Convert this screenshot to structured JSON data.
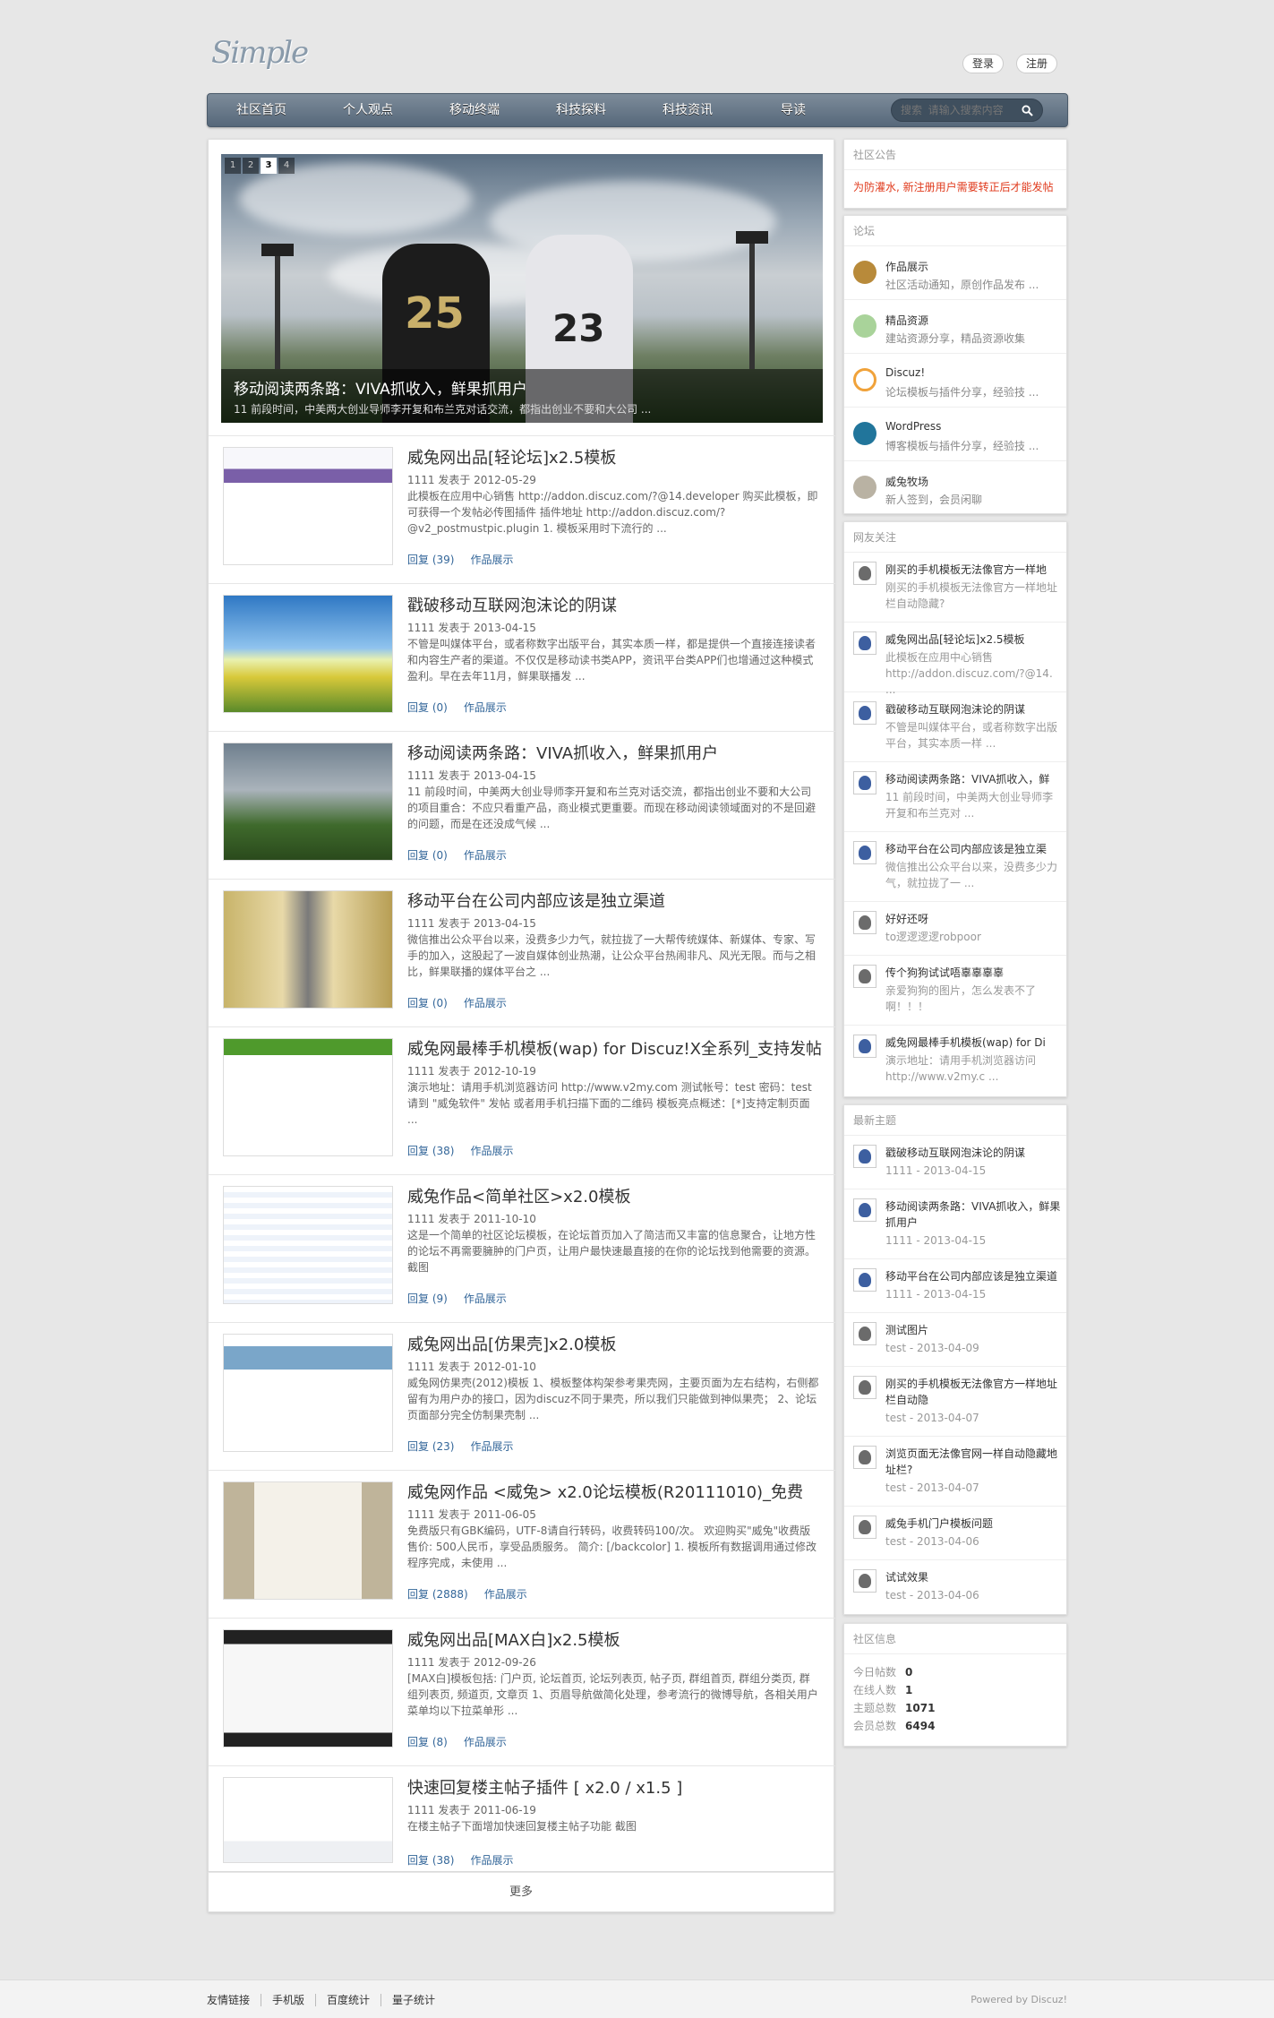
{
  "header": {
    "logo": "Simple",
    "login": "登录",
    "register": "注册"
  },
  "nav": {
    "items": [
      "社区首页",
      "个人观点",
      "移动终端",
      "科技探料",
      "科技资讯",
      "导读"
    ],
    "search_placeholder": "搜索  请输入搜索内容"
  },
  "slider": {
    "pages": [
      "1",
      "2",
      "3",
      "4"
    ],
    "active": "3",
    "title": "移动阅读两条路：VIVA抓收入，鲜果抓用户",
    "desc": "11 前段时间，中美两大创业导师李开复和布兰克对话交流，都指出创业不要和大公司 ..."
  },
  "posts": [
    {
      "title": "威兔网出品[轻论坛]x2.5模板",
      "meta": "1111 发表于 2012-05-29",
      "desc": "此模板在应用中心销售 http://addon.discuz.com/?@14.developer 购买此模板，即可获得一个发帖必传图插件 插件地址 http://addon.discuz.com/?@v2_postmustpic.plugin 1. 模板采用时下流行的 ...",
      "reply": "回复 (39)",
      "cat": "作品展示"
    },
    {
      "title": "戳破移动互联网泡沫论的阴谋",
      "meta": "1111 发表于 2013-04-15",
      "desc": "不管是叫媒体平台，或者称数字出版平台，其实本质一样，都是提供一个直接连接读者和内容生产者的渠道。不仅仅是移动读书类APP，资讯平台类APP们也增通过这种模式盈利。早在去年11月，鲜果联播发 ...",
      "reply": "回复 (0)",
      "cat": "作品展示"
    },
    {
      "title": "移动阅读两条路：VIVA抓收入，鲜果抓用户",
      "meta": "1111 发表于 2013-04-15",
      "desc": "11 前段时间，中美两大创业导师李开复和布兰克对话交流，都指出创业不要和大公司的项目重合：不应只看重产品，商业模式更重要。而现在移动阅读领域面对的不是回避的问题，而是在还没成气候 ...",
      "reply": "回复 (0)",
      "cat": "作品展示"
    },
    {
      "title": "移动平台在公司内部应该是独立渠道",
      "meta": "1111 发表于 2013-04-15",
      "desc": "微信推出公众平台以来，没费多少力气，就拉拢了一大帮传统媒体、新媒体、专家、写手的加入，这股起了一波自媒体创业热潮，让公众平台热闹非凡、风光无限。而与之相比，鲜果联播的媒体平台之 ...",
      "reply": "回复 (0)",
      "cat": "作品展示"
    },
    {
      "title": "威兔网最棒手机模板(wap) for Discuz!X全系列_支持发帖",
      "meta": "1111 发表于 2012-10-19",
      "desc": "演示地址：请用手机浏览器访问 http://www.v2my.com 测试帐号：test 密码：test 请到 \"威兔软件\" 发帖 或者用手机扫描下面的二维码 模板亮点概述：[*]支持定制页面 ...",
      "reply": "回复 (38)",
      "cat": "作品展示"
    },
    {
      "title": "威兔作品<简单社区>x2.0模板",
      "meta": "1111 发表于 2011-10-10",
      "desc": "这是一个简单的社区论坛模板，在论坛首页加入了简洁而又丰富的信息聚合，让地方性的论坛不再需要臃肿的门户页，让用户最快速最直接的在你的论坛找到他需要的资源。截图",
      "reply": "回复 (9)",
      "cat": "作品展示"
    },
    {
      "title": "威兔网出品[仿果壳]x2.0模板",
      "meta": "1111 发表于 2012-01-10",
      "desc": "威兔网仿果壳(2012)模板 1、模板整体构架参考果壳网，主要页面为左右结构，右侧都留有为用户办的接口，因为discuz不同于果壳，所以我们只能做到神似果壳； 2、论坛页面部分完全仿制果壳制 ...",
      "reply": "回复 (23)",
      "cat": "作品展示"
    },
    {
      "title": "威兔网作品 <威兔> x2.0论坛模板(R20111010)_免费",
      "meta": "1111 发表于 2011-06-05",
      "desc": "免费版只有GBK编码，UTF-8请自行转码，收费转码100/次。 欢迎购买\"威兔\"收费版 售价: 500人民币，享受品质服务。 简介: [/backcolor] 1. 模板所有数据调用通过修改程序完成，未使用 ...",
      "reply": "回复 (2888)",
      "cat": "作品展示"
    },
    {
      "title": "威兔网出品[MAX白]x2.5模板",
      "meta": "1111 发表于 2012-09-26",
      "desc": "[MAX白]模板包括: 门户页, 论坛首页, 论坛列表页, 帖子页, 群组首页, 群组分类页, 群组列表页, 频道页, 文章页 1、页眉导航做简化处理，参考流行的微博导航，各相关用户菜单均以下拉菜单形 ...",
      "reply": "回复 (8)",
      "cat": "作品展示"
    },
    {
      "title": "快速回复楼主帖子插件 [ x2.0 / x1.5 ]",
      "meta": "1111 发表于 2011-06-19",
      "desc": "在楼主帖子下面增加快速回复楼主帖子功能 截图",
      "reply": "回复 (38)",
      "cat": "作品展示"
    }
  ],
  "more": "更多",
  "notice": {
    "title": "社区公告",
    "text": "为防灌水, 新注册用户需要转正后才能发帖"
  },
  "forums": {
    "title": "论坛",
    "items": [
      {
        "name": "作品展示",
        "desc": "社区活动通知，原创作品发布 ..."
      },
      {
        "name": "精品资源",
        "desc": "建站资源分享，精品资源收集"
      },
      {
        "name": "Discuz!",
        "desc": "论坛模板与插件分享，经验技 ..."
      },
      {
        "name": "WordPress",
        "desc": "博客模板与插件分享，经验技 ..."
      },
      {
        "name": "威兔牧场",
        "desc": "新人签到，会员闲聊"
      }
    ]
  },
  "friends": {
    "title": "网友关注",
    "items": [
      {
        "title": "刚买的手机模板无法像官方一样地",
        "desc": "刚买的手机模板无法像官方一样地址栏自动隐藏?"
      },
      {
        "title": "威兔网出品[轻论坛]x2.5模板",
        "desc": "此模板在应用中心销售 http://addon.discuz.com/?@14. ..."
      },
      {
        "title": "戳破移动互联网泡沫论的阴谋",
        "desc": "不管是叫媒体平台，或者称数字出版平台，其实本质一样 ..."
      },
      {
        "title": "移动阅读两条路：VIVA抓收入，鲜",
        "desc": "11 前段时间，中美两大创业导师李开复和布兰克对 ..."
      },
      {
        "title": "移动平台在公司内部应该是独立渠",
        "desc": "微信推出公众平台以来，没费多少力气，就拉拢了一 ..."
      },
      {
        "title": "好好还呀",
        "desc": "to逻逻逻逻robpoor"
      },
      {
        "title": "传个狗狗试试唔辜辜辜辜",
        "desc": "亲爱狗狗的图片，怎么发表不了啊！！！"
      },
      {
        "title": "威兔网最棒手机模板(wap) for Di",
        "desc": "演示地址：请用手机浏览器访问 http://www.v2my.c ..."
      }
    ]
  },
  "latest": {
    "title": "最新主题",
    "items": [
      {
        "title": "戳破移动互联网泡沫论的阴谋",
        "meta": "1111 - 2013-04-15"
      },
      {
        "title": "移动阅读两条路：VIVA抓收入，鲜果抓用户",
        "meta": "1111 - 2013-04-15"
      },
      {
        "title": "移动平台在公司内部应该是独立渠道",
        "meta": "1111 - 2013-04-15"
      },
      {
        "title": "测试图片",
        "meta": "test - 2013-04-09"
      },
      {
        "title": "刚买的手机模板无法像官方一样地址栏自动隐",
        "meta": "test - 2013-04-07"
      },
      {
        "title": "浏览页面无法像官网一样自动隐藏地址栏?",
        "meta": "test - 2013-04-07"
      },
      {
        "title": "威兔手机门户模板问题",
        "meta": "test - 2013-04-06"
      },
      {
        "title": "试试效果",
        "meta": "test - 2013-04-06"
      }
    ]
  },
  "stats": {
    "title": "社区信息",
    "items": [
      {
        "label": "今日帖数",
        "value": "0"
      },
      {
        "label": "在线人数",
        "value": "1"
      },
      {
        "label": "主题总数",
        "value": "1071"
      },
      {
        "label": "会员总数",
        "value": "6494"
      }
    ]
  },
  "footer": {
    "links": [
      "友情链接",
      "手机版",
      "百度统计",
      "量子统计"
    ],
    "power": "Powered by Discuz!"
  }
}
